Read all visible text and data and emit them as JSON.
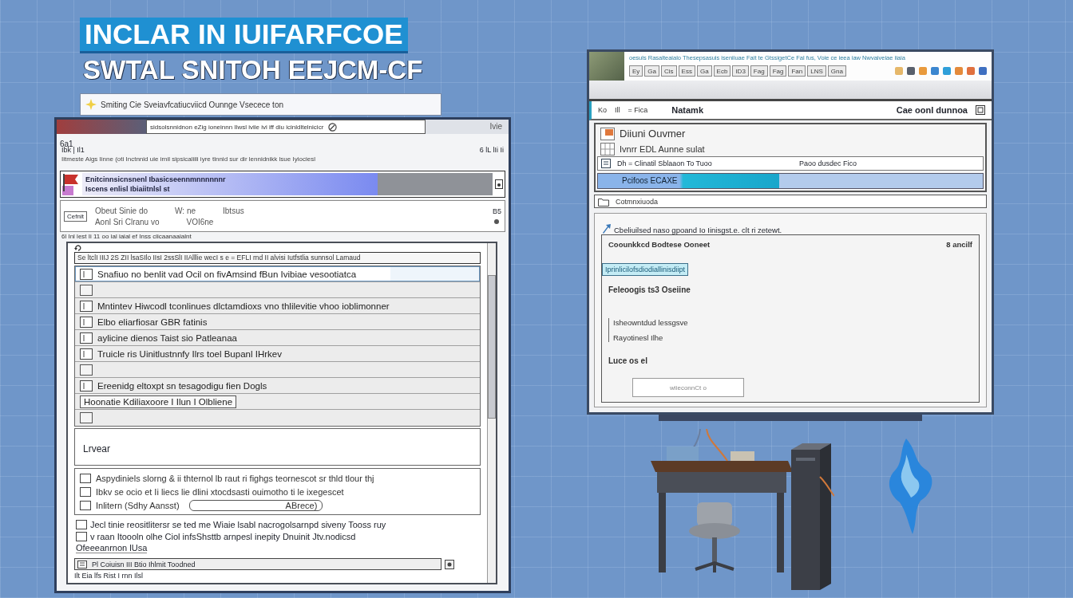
{
  "title": {
    "line_1": "INCLAR IN IUIFARFCOE",
    "line_2": "SWTAL SNITOH EEJCM-CF"
  },
  "back_window": {
    "text": "Smiting Cie Sveiavfcatiucviicd Ounnge Vsecece ton"
  },
  "left_window": {
    "address": "sidsolsnnidnon eZig ioneinnn Ilwsl iviie ivi iff diu icinldltelnicicr",
    "corner": "Ivie",
    "label": "6a1",
    "toolbar_left": "Ibk | Il1",
    "toolbar_right": "6 lL lIi Ii",
    "menu": "Iitmeste Aigs Iinne (oti Inctnnid uie irnil sipsicaliili iyre tlnnid sur dir lennidnikk lsue Iyiociesl",
    "banner": {
      "line_1": "Enitcinnsicnsnenl Ibasicseennmnnnnnnr",
      "line_2": "Iscens enlisl Ibiaiitnlsl st",
      "level": 0.72
    },
    "panel": {
      "tag": "Cefnit",
      "line_1": [
        "Obeut Sinie do",
        "W: ne",
        "Ibtsus"
      ],
      "line_2": [
        "Aonl Sri Clranu vo",
        "VOI6ne"
      ],
      "badge": "B5"
    },
    "status_line": "6l Inl lest Ii 11 oo ial iaial ef Inss ciicaanaaialnt",
    "inner": {
      "toolbar": "Se ltclI IIIJ 2S ZII lsaSIlo IIsI 2ssSlI IIAlllie wecI s e = EFLI rnd II alvisi Iutfstlia sunnsol Lamaud",
      "rows": [
        {
          "kind": "item",
          "text": "Snafiuo no benlit vad Ocil on fivAmsind fBun Ivibiae vesootiatca",
          "selected": true
        },
        {
          "kind": "blank",
          "selected": false
        },
        {
          "kind": "item",
          "text": "Mntintev Hiwcodl tconlinues dlctamdioxs vno thlilevitie vhoo ioblimonner",
          "selected": false
        },
        {
          "kind": "item",
          "text": "Elbo eliarfiosar GBR fatinis",
          "selected": false
        },
        {
          "kind": "item",
          "text": "aylicine dienos Taist sio Patleanaa",
          "selected": false
        },
        {
          "kind": "item",
          "text": "Truicle ris Uinitlustnnfy Ilrs toel Bupanl IHrkev",
          "selected": false
        },
        {
          "kind": "blank",
          "selected": false
        },
        {
          "kind": "item",
          "text": "Ereenidg eltoxpt sn tesagodigu fien Dogls",
          "selected": false
        },
        {
          "kind": "box",
          "text": "Hoonatie Kdiliaxoore I Ilun I Olbliene",
          "selected": false
        },
        {
          "kind": "blank",
          "selected": false
        }
      ],
      "text_area": "Lrvear",
      "group": {
        "lines": [
          "Aspydiniels slorng & ii thternol lb raut ri fighgs teornescot sr thld tlour thj",
          "Ibkv se ocio et Ii liecs lie dlini xtocdsasti ouimotho ti le ixegescet"
        ],
        "label": "Inlitern (Sdhy Aansst)",
        "value": "ABrece)"
      },
      "notes": [
        {
          "kind": "check",
          "text": "Jecl tinie reositlitersr se ted me Wiaie lsabl nacrogolsarnpd siveny Tooss ruy"
        },
        {
          "kind": "check",
          "text": "v raan Itoooln olhe Ciol infsShsttb arnpesl inepity Dnuinit Jtv.nodicsd"
        },
        {
          "kind": "plain",
          "text": "Ofeeeanrnon lUsa"
        }
      ],
      "field": "Pl Coiuisn III Btio Ihlmit Toodned",
      "footer": "Ilt Eia lfs Rist I rnn Ilsl"
    }
  },
  "right_window": {
    "caption": "oesuls Rasalteaialo Thesepsasuis iseniiuae Fait te GtssigetCe Fal fus, Voie ce ieea iaw Nwvaiveiae iiaia",
    "tools": [
      "Ey",
      "Ga",
      "Cis",
      "Ess",
      "Ga",
      "Ecb",
      "ID3",
      "Fag",
      "Fag",
      "Fan",
      "LNS",
      "Gna"
    ],
    "color_icons": [
      {
        "color": "#e6b86a"
      },
      {
        "color": "#59606c"
      },
      {
        "color": "#e99a3c"
      },
      {
        "color": "#3b86cf"
      },
      {
        "color": "#2f9fd9"
      },
      {
        "color": "#e48a3a"
      },
      {
        "color": "#e0703e"
      },
      {
        "color": "#3e6fc0"
      }
    ],
    "header_tabs": [
      "Ko",
      "Ill",
      "= Fica"
    ],
    "header_title": "Natamk",
    "header_right": "Cae oonl dunnoa",
    "owner": "Diiuni Ouvmer",
    "owner_detail": "Ivnrr EDL Aunne sulat",
    "field": {
      "label": "Dh = Clinatil Sblaaon To Tuoo",
      "value": "Paoo dusdec Fico"
    },
    "progress": {
      "label": "Pcifoos ECAXE",
      "level": 0.47
    },
    "row": "Cotmnxiuoda",
    "content": {
      "intro": "Cbeliuilsed naso gpoand Io Iinisgst.e. clt ri zetewt.",
      "box_title": "Coounkkcd Bodtese Ooneet",
      "box_count": "8 ancilf",
      "highlight": "Iprinlicilofsdiodiallinisdiipt",
      "note": "Feleoogis ts3 Oseiine",
      "details": [
        "Isheowntdud lessgsve",
        "Rayotinesl Ilhe"
      ],
      "footer": "Luce os el",
      "field": "wiieconnCt o"
    }
  }
}
